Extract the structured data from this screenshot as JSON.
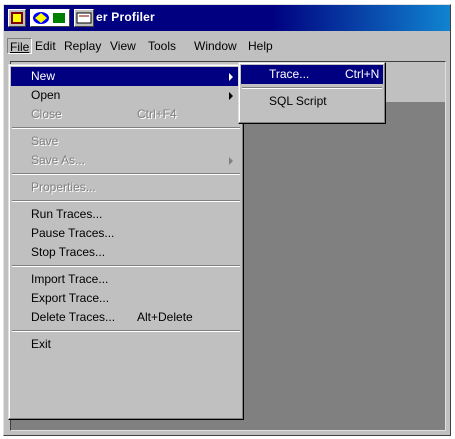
{
  "window": {
    "title": "er Profiler"
  },
  "menubar": {
    "items": [
      "File",
      "Edit",
      "Replay",
      "View",
      "Tools",
      "Window",
      "Help"
    ]
  },
  "file_menu": {
    "new": {
      "label": "New",
      "mnemonic": "N"
    },
    "open": {
      "label": "Open"
    },
    "close": {
      "label": "Close",
      "shortcut": "Ctrl+F4"
    },
    "save": {
      "label": "Save"
    },
    "save_as": {
      "label": "Save As..."
    },
    "properties": {
      "label": "Properties..."
    },
    "run_traces": {
      "label": "Run Traces..."
    },
    "pause_traces": {
      "label": "Pause Traces..."
    },
    "stop_traces": {
      "label": "Stop Traces..."
    },
    "import_trace": {
      "label": "Import Trace..."
    },
    "export_trace": {
      "label": "Export Trace..."
    },
    "delete_traces": {
      "label": "Delete Traces...",
      "shortcut": "Alt+Delete"
    },
    "exit": {
      "label": "Exit"
    }
  },
  "new_menu": {
    "trace": {
      "label": "Trace...",
      "shortcut": "Ctrl+N"
    },
    "sql_script": {
      "label": "SQL Script"
    }
  },
  "colors": {
    "highlight": "#000080",
    "face": "#c0c0c0",
    "client": "#808080"
  }
}
